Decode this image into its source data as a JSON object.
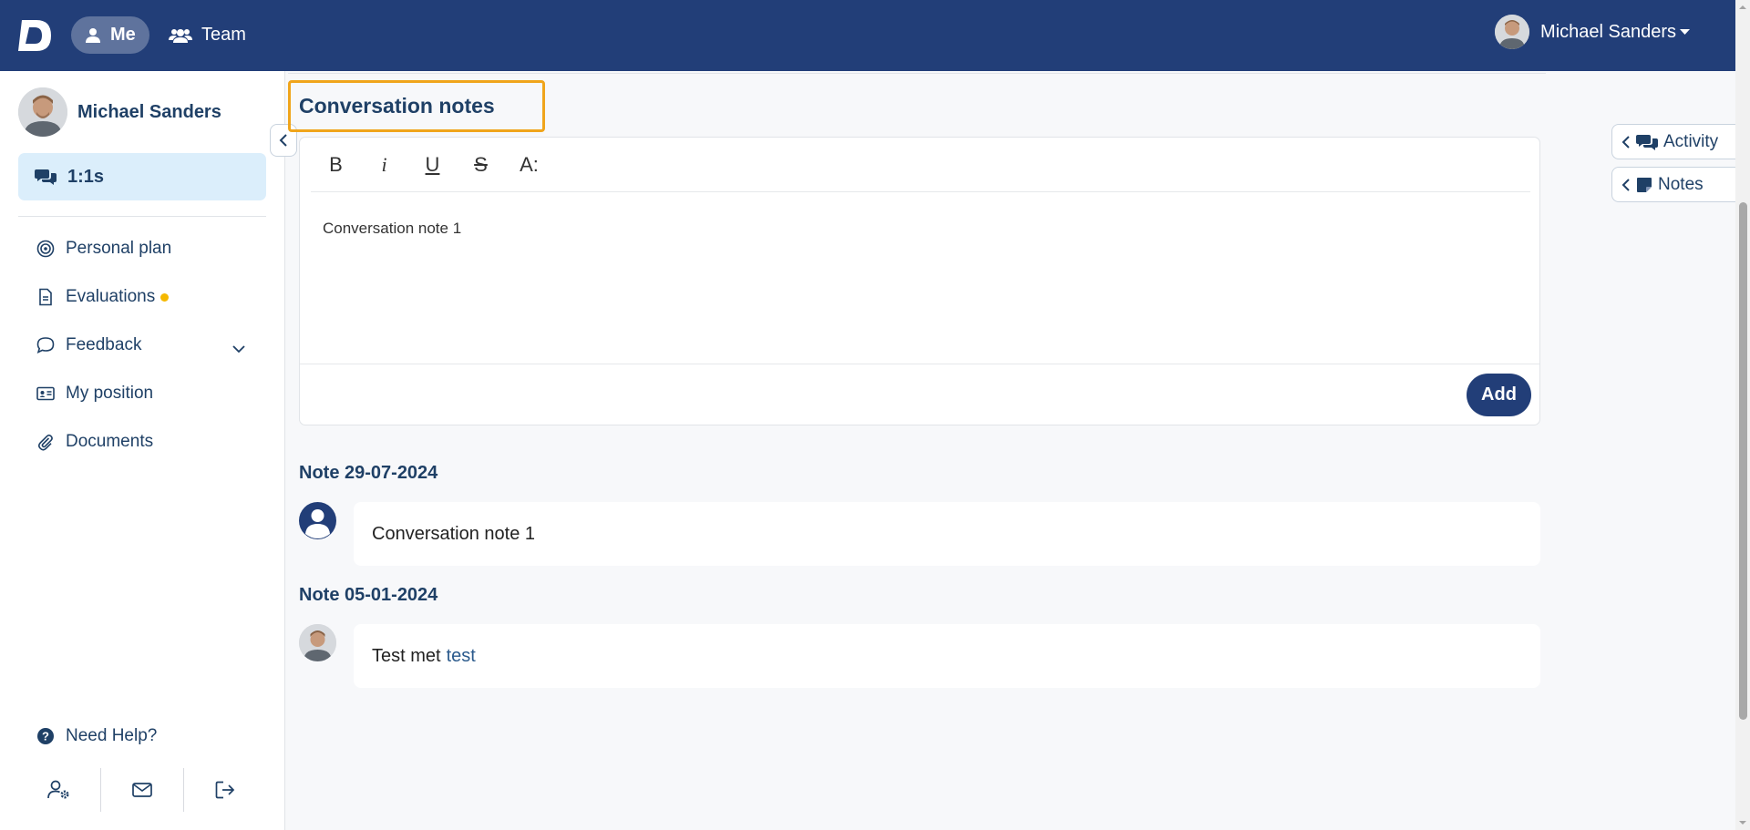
{
  "app": {
    "logo_letter": "D",
    "brand_color": "#223e78",
    "accent_color": "#f0a51b"
  },
  "topbar": {
    "nav": [
      {
        "label": "Me",
        "icon": "person-icon",
        "active": true
      },
      {
        "label": "Team",
        "icon": "team-icon",
        "active": false
      }
    ],
    "user_name": "Michael Sanders"
  },
  "sidebar": {
    "profile_name": "Michael Sanders",
    "active_item": {
      "label": "1:1s",
      "icon": "chat-bubbles-icon"
    },
    "items": [
      {
        "label": "Personal plan",
        "icon": "target-icon"
      },
      {
        "label": "Evaluations",
        "icon": "document-icon",
        "badge": "dot"
      },
      {
        "label": "Feedback",
        "icon": "speech-bubble-icon",
        "expandable": true
      },
      {
        "label": "My position",
        "icon": "id-card-icon"
      },
      {
        "label": "Documents",
        "icon": "paperclip-icon"
      }
    ],
    "help_label": "Need Help?",
    "bottom_icons": [
      "user-settings-icon",
      "mail-icon",
      "logout-icon"
    ]
  },
  "main": {
    "section_title": "Conversation notes",
    "editor": {
      "toolbar": [
        "B",
        "i",
        "U",
        "S",
        "A:"
      ],
      "content": "Conversation note 1",
      "add_label": "Add"
    },
    "notes": [
      {
        "title": "Note 29-07-2024",
        "text": "Conversation note 1",
        "link": "",
        "avatar": "default-user-avatar"
      },
      {
        "title": "Note 05-01-2024",
        "text": "Test met",
        "link": "test",
        "avatar": "profile-photo-avatar"
      }
    ]
  },
  "right_tabs": [
    {
      "label": "Activity",
      "icon": "chat-bubbles-icon"
    },
    {
      "label": "Notes",
      "icon": "sticky-note-icon"
    }
  ]
}
